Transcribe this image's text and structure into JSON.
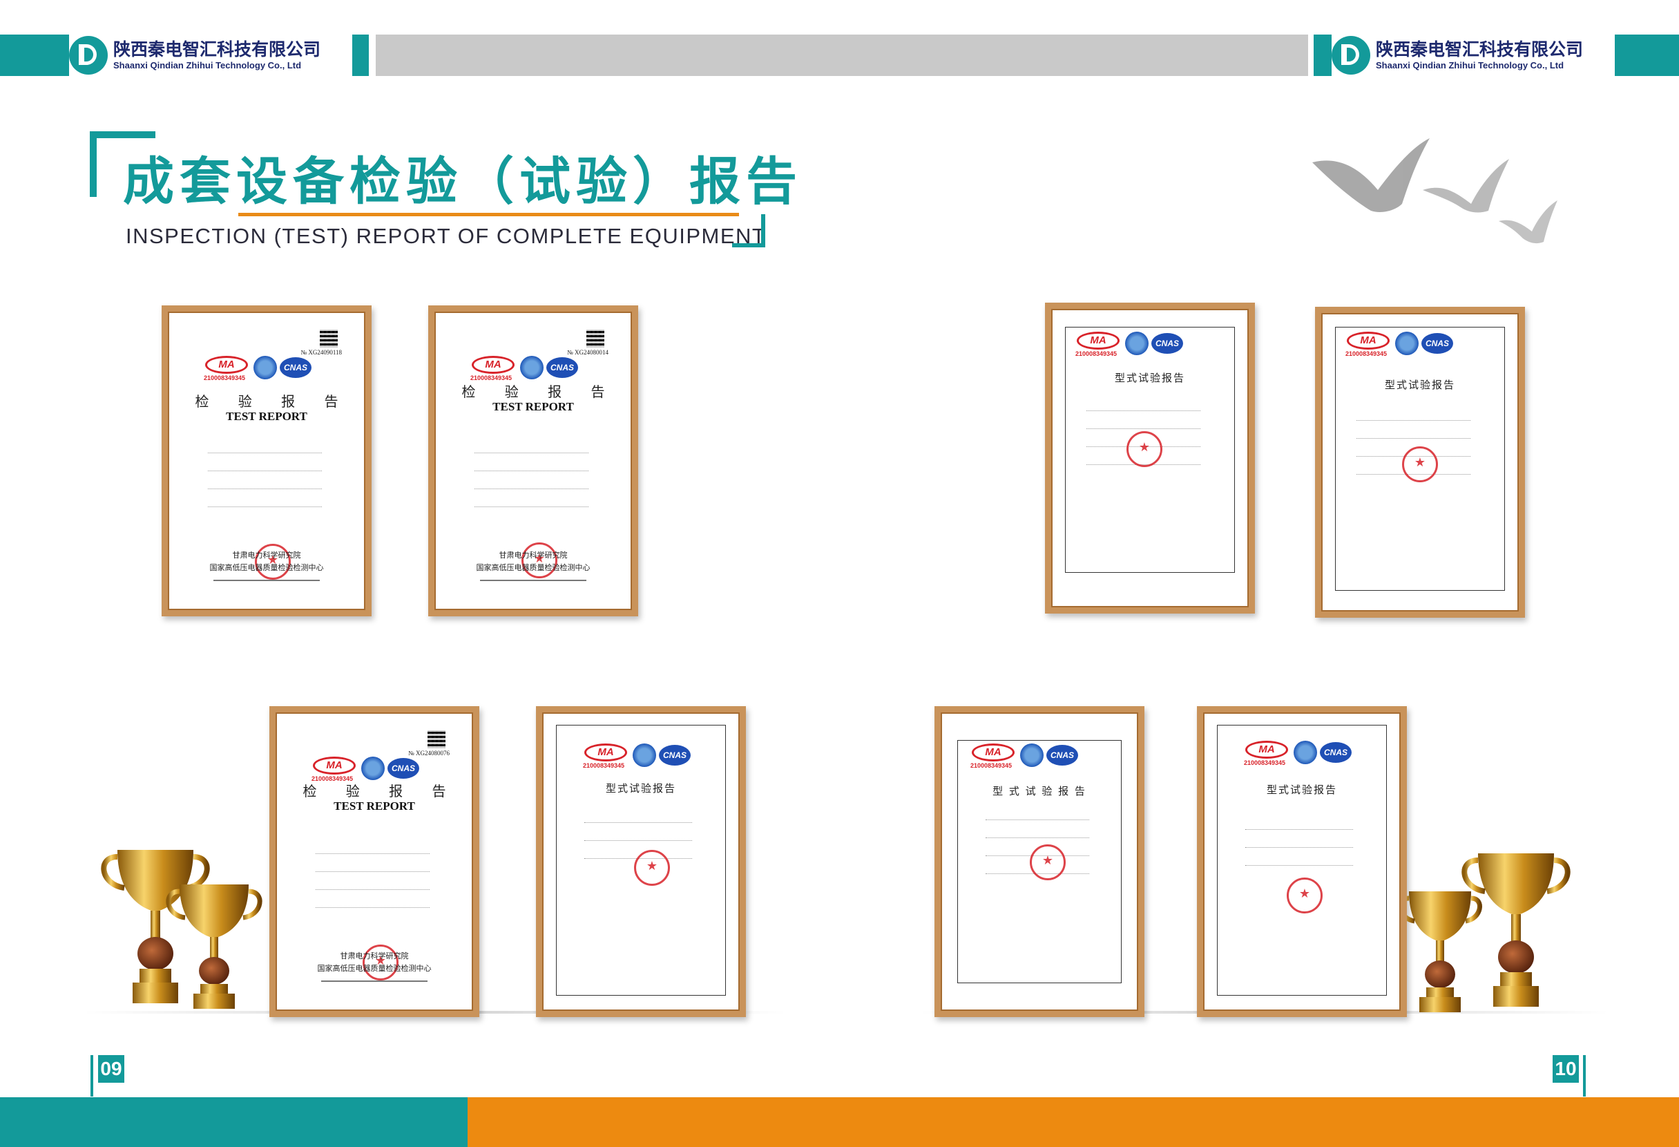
{
  "header": {
    "company_cn": "陕西秦电智汇科技有限公司",
    "company_en": "Shaanxi Qindian Zhihui Technology Co., Ltd"
  },
  "title": {
    "cn": "成套设备检验（试验）报告",
    "en": "INSPECTION (TEST) REPORT OF COMPLETE EQUIPMENT"
  },
  "certificates": [
    {
      "kind": "test",
      "title_cn": "检 验 报 告",
      "title_en": "TEST REPORT",
      "doc_no": "№ XG24090118",
      "ma": "MA",
      "ma_no": "210008349345",
      "cnas": "CNAS",
      "footer_cn1": "甘肃电力科学研究院",
      "footer_cn2": "国家高低压电器质量检验检测中心"
    },
    {
      "kind": "test",
      "title_cn": "检 验 报 告",
      "title_en": "TEST REPORT",
      "doc_no": "№ XG24080014",
      "ma": "MA",
      "ma_no": "210008349345",
      "cnas": "CNAS",
      "footer_cn1": "甘肃电力科学研究院",
      "footer_cn2": "国家高低压电器质量检验检测中心"
    },
    {
      "kind": "type",
      "title_cn": "型式试验报告",
      "ma": "MA",
      "ma_no": "210008349345",
      "cnas": "CNAS"
    },
    {
      "kind": "type",
      "title_cn": "型式试验报告",
      "ma": "MA",
      "ma_no": "210008349345",
      "cnas": "CNAS"
    },
    {
      "kind": "test",
      "title_cn": "检 验 报 告",
      "title_en": "TEST REPORT",
      "doc_no": "№ XG24080076",
      "ma": "MA",
      "ma_no": "210008349345",
      "cnas": "CNAS",
      "footer_cn1": "甘肃电力科学研究院",
      "footer_cn2": "国家高低压电器质量检验检测中心"
    },
    {
      "kind": "type",
      "title_cn": "型式试验报告",
      "ma": "MA",
      "ma_no": "210008349345",
      "cnas": "CNAS"
    },
    {
      "kind": "type",
      "title_cn": "型 式 试 验 报 告",
      "ma": "MA",
      "ma_no": "210008349345",
      "cnas": "CNAS"
    },
    {
      "kind": "type",
      "title_cn": "型式试验报告",
      "ma": "MA",
      "ma_no": "210008349345",
      "cnas": "CNAS"
    }
  ],
  "pages": {
    "left": "09",
    "right": "10"
  },
  "colors": {
    "teal": "#139a9a",
    "orange": "#ed8a10",
    "gray": "#c9c9c9",
    "frame": "#c9935a",
    "navy": "#1e2a6e"
  }
}
